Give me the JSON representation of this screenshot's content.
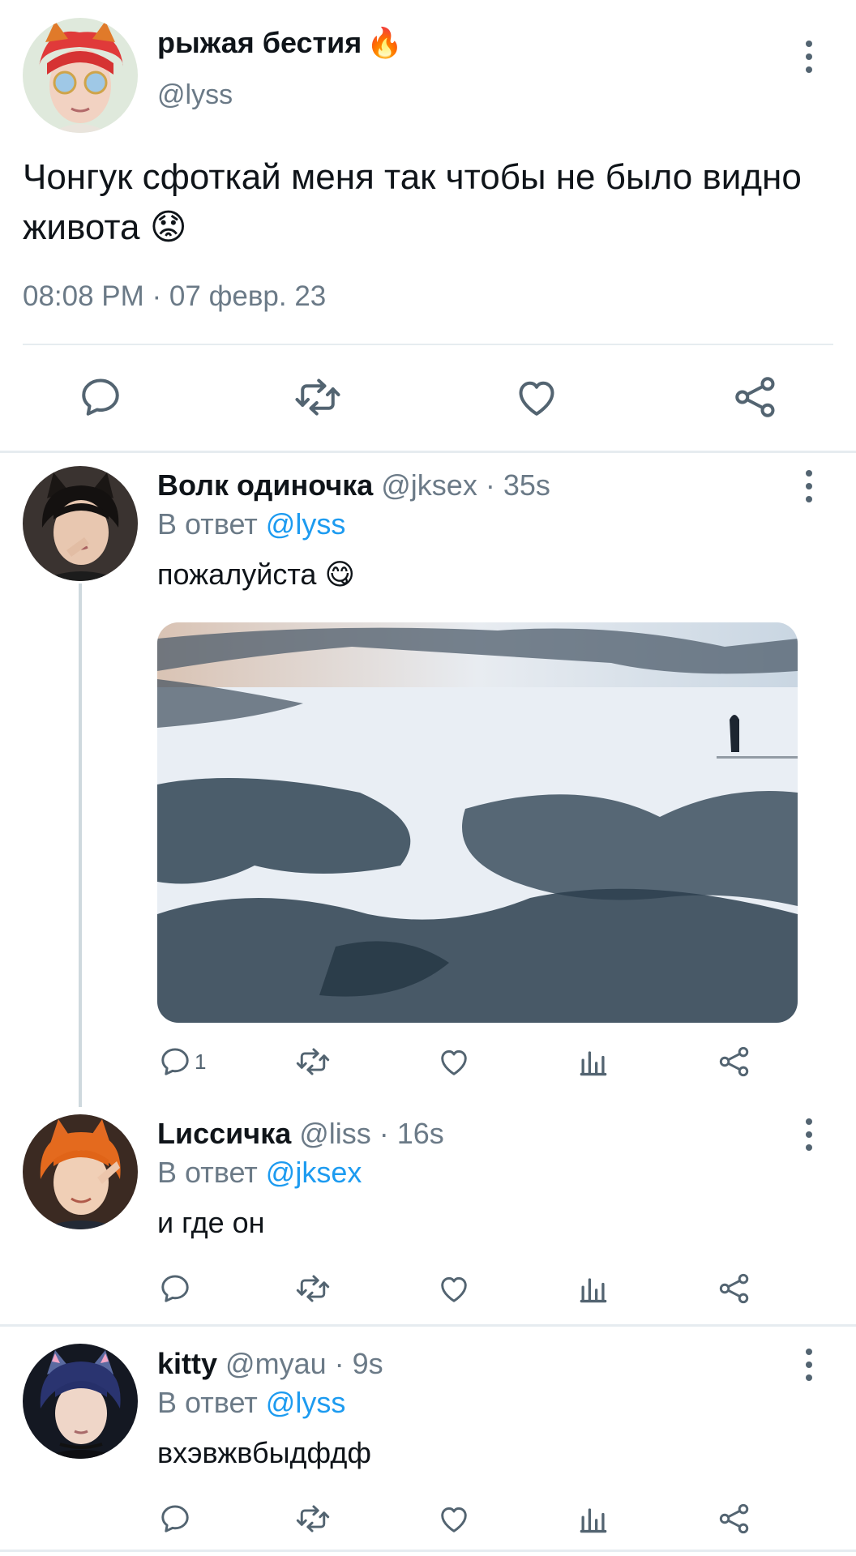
{
  "main_tweet": {
    "author_name": "рыжая бестия",
    "author_emoji": "🔥",
    "handle": "@lyss",
    "text": "Чонгук сфоткай меня так чтобы не было видно живота 😟",
    "timestamp": "08:08 PM · 07 февр. 23"
  },
  "replies": [
    {
      "name": "Волк одиночка",
      "meta": "@jksex · 35s",
      "reply_prefix": "В ответ",
      "reply_to": "@lyss",
      "text": "пожалуйста 😋",
      "reply_count": "1"
    },
    {
      "name": "Lиссичка",
      "meta": "@liss · 16s",
      "reply_prefix": "В ответ",
      "reply_to": "@jksex",
      "text": "и где он",
      "reply_count": ""
    },
    {
      "name": "kitty",
      "meta": "@myau · 9s",
      "reply_prefix": "В ответ",
      "reply_to": "@lyss",
      "text": "вхэвжвбыдфдф",
      "reply_count": ""
    }
  ],
  "icons": [
    "reply-icon",
    "retweet-icon",
    "like-icon",
    "share-icon",
    "analytics-icon",
    "more-icon"
  ],
  "colors": {
    "mention": "#1d9bf0",
    "muted": "#6b7a87",
    "icon": "#536471",
    "divider": "#e6ecf0"
  }
}
